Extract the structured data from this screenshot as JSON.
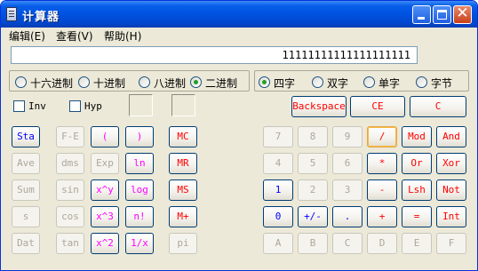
{
  "window": {
    "title": "计算器",
    "icon": "calculator-icon",
    "controls": {
      "minimize": "minimize-icon",
      "maximize": "maximize-icon",
      "close": "✕"
    }
  },
  "menu": [
    "编辑(E)",
    "查看(V)",
    "帮助(H)"
  ],
  "display": {
    "value": "11111111111111111111"
  },
  "number_base": [
    {
      "label": "十六进制",
      "selected": false
    },
    {
      "label": "十进制",
      "selected": false
    },
    {
      "label": "八进制",
      "selected": false
    },
    {
      "label": "二进制",
      "selected": true
    }
  ],
  "word_size": [
    {
      "label": "四字",
      "selected": true
    },
    {
      "label": "双字",
      "selected": false
    },
    {
      "label": "单字",
      "selected": false
    },
    {
      "label": "字节",
      "selected": false
    }
  ],
  "checkboxes": [
    {
      "label": "Inv",
      "checked": false
    },
    {
      "label": "Hyp",
      "checked": false
    }
  ],
  "edit_buttons": {
    "backspace": "Backspace",
    "ce": "CE",
    "c": "C"
  },
  "sci_buttons": [
    "Sta",
    "F-E",
    "(",
    ")",
    "Ave",
    "dms",
    "Exp",
    "ln",
    "Sum",
    "sin",
    "x^y",
    "log",
    "s",
    "cos",
    "x^3",
    "n!",
    "Dat",
    "tan",
    "x^2",
    "1/x"
  ],
  "memory_buttons": [
    "MC",
    "MR",
    "MS",
    "M+",
    "pi"
  ],
  "keypad": [
    "7",
    "8",
    "9",
    "/",
    "Mod",
    "And",
    "4",
    "5",
    "6",
    "*",
    "Or",
    "Xor",
    "1",
    "2",
    "3",
    "-",
    "Lsh",
    "Not",
    "0",
    "+/-",
    ".",
    "+",
    "=",
    "Int",
    "A",
    "B",
    "C",
    "D",
    "E",
    "F"
  ],
  "colors": {
    "title_bar": "#0054e3",
    "face": "#ece9d8",
    "text_blue": "#0000ff",
    "text_red": "#ff0000",
    "text_purple": "#ff00ff",
    "disabled": "#aca899"
  }
}
